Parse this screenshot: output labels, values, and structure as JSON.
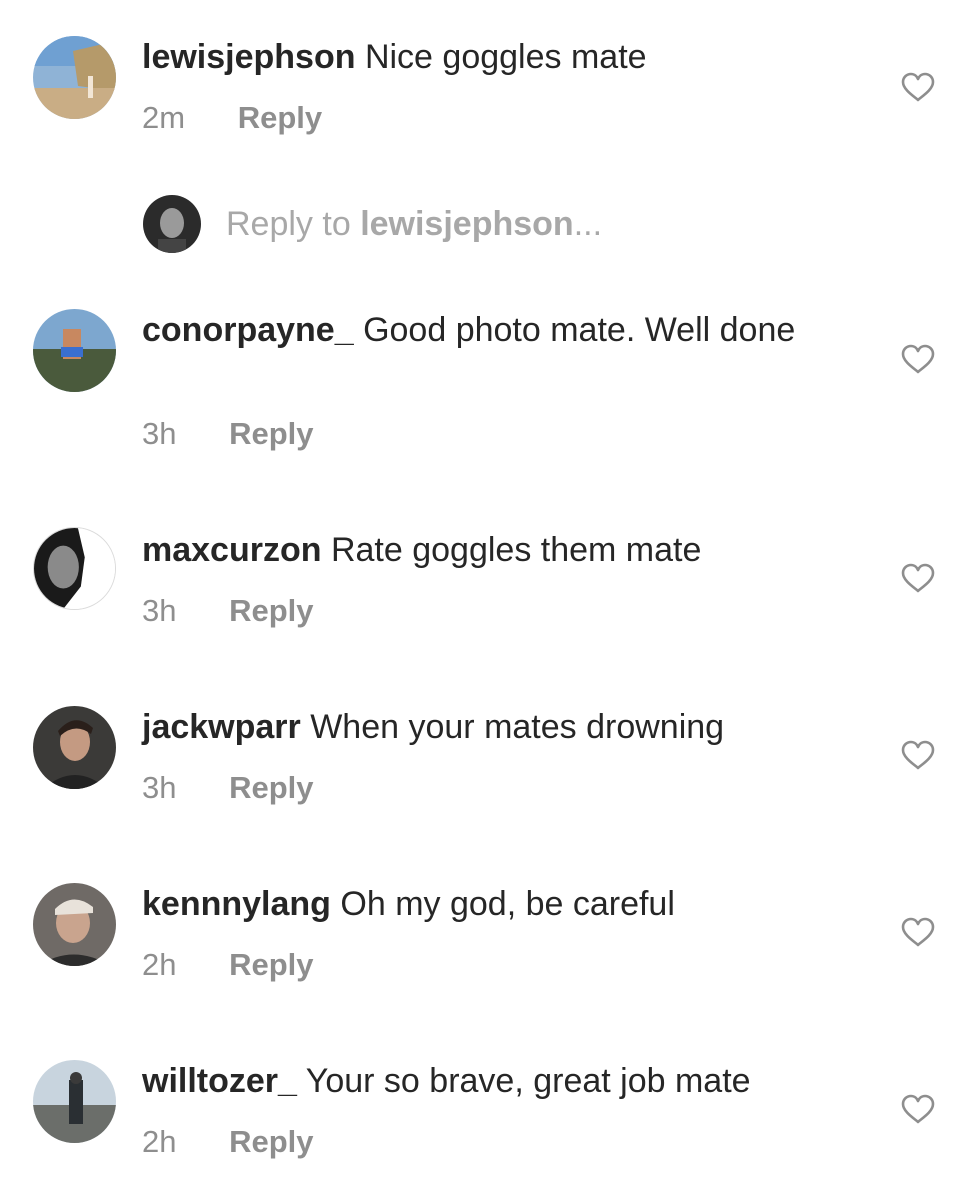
{
  "comments": [
    {
      "username": "lewisjephson",
      "text": "Nice goggles mate",
      "time": "2m",
      "reply": "Reply"
    },
    {
      "username": "conorpayne_",
      "text": "Good photo mate. Well done",
      "time": "3h",
      "reply": "Reply"
    },
    {
      "username": "maxcurzon",
      "text": "Rate goggles them mate",
      "time": "3h",
      "reply": "Reply"
    },
    {
      "username": "jackwparr",
      "text": "When your mates drowning",
      "time": "3h",
      "reply": "Reply"
    },
    {
      "username": "kennnylang",
      "text": "Oh my god, be careful",
      "time": "2h",
      "reply": "Reply"
    },
    {
      "username": "willtozer_",
      "text": "Your so brave, great job mate",
      "time": "2h",
      "reply": "Reply"
    }
  ],
  "reply_composer": {
    "prefix": "Reply to ",
    "target": "lewisjephson",
    "suffix": "..."
  },
  "colors": {
    "text": "#262626",
    "secondary": "#8e8e8e",
    "placeholder": "#a8a8a8"
  },
  "icons": {
    "like": "heart-outline-icon"
  }
}
